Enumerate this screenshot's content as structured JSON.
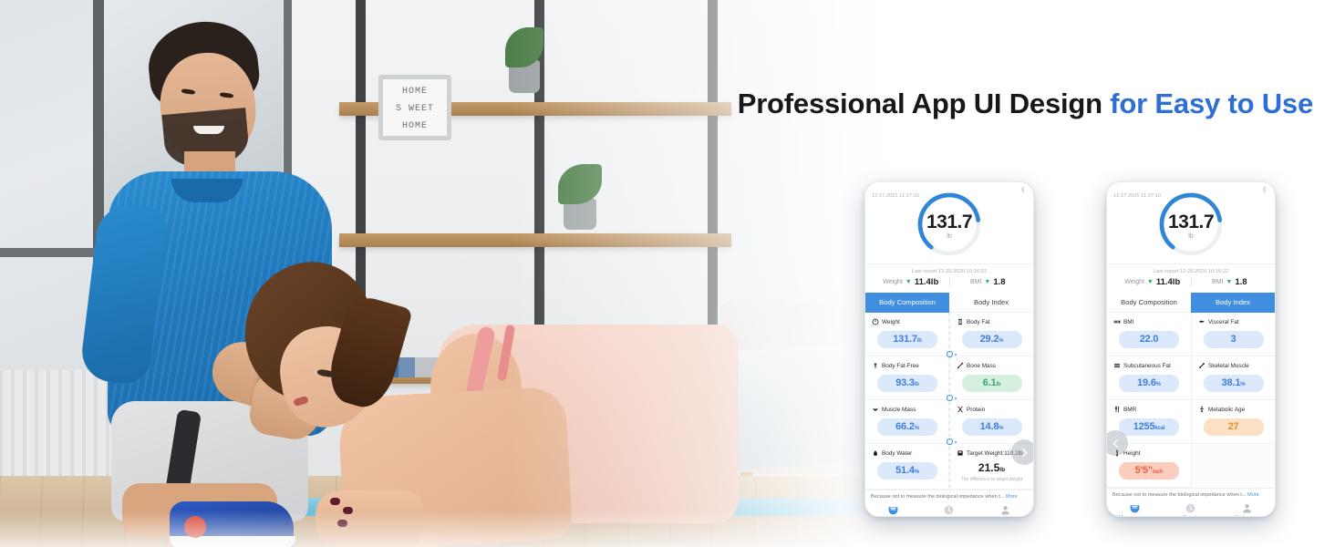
{
  "headline": {
    "text_main": "Professional App UI Design ",
    "text_accent": "for Easy to Use"
  },
  "phones": [
    {
      "id": "phone-1",
      "status": {
        "time": "12.17.2021 11:27:10",
        "bluetooth_icon": "bluetooth-icon"
      },
      "gauge": {
        "value": "131.7",
        "unit": "lb",
        "arc_color": "#2f86d8",
        "track_color": "#eceff1"
      },
      "last_report": "Last report 12.26.2020 10:16:22",
      "kpis": [
        {
          "label": "Weight",
          "arrow": "▼",
          "value": "11.4lb",
          "arrow_color": "#25b865"
        },
        {
          "label": "BMI",
          "arrow": "▼",
          "value": "1.8",
          "arrow_color": "#25b865"
        }
      ],
      "tabs": [
        {
          "label": "Body Composition",
          "active": true
        },
        {
          "label": "Body Index",
          "active": false
        }
      ],
      "cells": [
        {
          "icon": "body-weight-icon",
          "label": "Weight",
          "value": "131.7",
          "unit": "lb",
          "style": "pill-blue"
        },
        {
          "icon": "body-fat-icon",
          "label": "Body Fat",
          "value": "29.2",
          "unit": "%",
          "style": "pill-blue"
        },
        {
          "icon": "body-fat-free-icon",
          "label": "Body Fat-Free",
          "value": "93.3",
          "unit": "lb",
          "style": "pill-blue"
        },
        {
          "icon": "bone-mass-icon",
          "label": "Bone Mass",
          "value": "6.1",
          "unit": "lb",
          "style": "pill-green"
        },
        {
          "icon": "muscle-mass-icon",
          "label": "Muscle Mass",
          "value": "66.2",
          "unit": "%",
          "style": "pill-blue"
        },
        {
          "icon": "protein-icon",
          "label": "Protein",
          "value": "14.8",
          "unit": "%",
          "style": "pill-blue"
        },
        {
          "icon": "body-water-icon",
          "label": "Body Water",
          "value": "51.4",
          "unit": "%",
          "style": "pill-blue"
        },
        {
          "icon": "target-weight-icon",
          "label": "Target Weight:110.2lb",
          "value": "21.5",
          "unit": "lb",
          "style": "plain",
          "note": "The difference to target weight"
        }
      ],
      "arrow": {
        "name": "next-page-arrow",
        "glyph": "next"
      },
      "footnote": {
        "text": "Because not to measure the biological impedance when t...",
        "more": "More"
      },
      "bottom_nav": [
        {
          "icon": "measurements-icon",
          "label": "Measurements",
          "active": true
        },
        {
          "icon": "trends-icon",
          "label": "Trends",
          "active": false
        },
        {
          "icon": "account-icon",
          "label": "My Account",
          "active": false
        }
      ]
    },
    {
      "id": "phone-2",
      "status": {
        "time": "12.17.2021 11:27:10",
        "bluetooth_icon": "bluetooth-icon"
      },
      "gauge": {
        "value": "131.7",
        "unit": "lb",
        "arc_color": "#2f86d8",
        "track_color": "#eceff1"
      },
      "last_report": "Last report 12.26.2020 10:16:22",
      "kpis": [
        {
          "label": "Weight",
          "arrow": "▼",
          "value": "11.4lb",
          "arrow_color": "#25b865"
        },
        {
          "label": "BMI",
          "arrow": "▼",
          "value": "1.8",
          "arrow_color": "#25b865"
        }
      ],
      "tabs": [
        {
          "label": "Body Composition",
          "active": false
        },
        {
          "label": "Body Index",
          "active": true
        }
      ],
      "cells": [
        {
          "icon": "bmi-icon",
          "label": "BMI",
          "value": "22.0",
          "unit": "",
          "style": "pill-blue"
        },
        {
          "icon": "visceral-fat-icon",
          "label": "Visceral Fat",
          "value": "3",
          "unit": "",
          "style": "pill-blue"
        },
        {
          "icon": "subcutaneous-fat-icon",
          "label": "Subcutaneous Fat",
          "value": "19.6",
          "unit": "%",
          "style": "pill-blue"
        },
        {
          "icon": "skeletal-muscle-icon",
          "label": "Skeletal Muscle",
          "value": "38.1",
          "unit": "%",
          "style": "pill-blue"
        },
        {
          "icon": "bmr-icon",
          "label": "BMR",
          "value": "1255",
          "unit": "kcal",
          "style": "pill-blue"
        },
        {
          "icon": "metabolic-age-icon",
          "label": "Metabolic Age",
          "value": "27",
          "unit": "",
          "style": "pill-orange"
        },
        {
          "icon": "height-icon",
          "label": "Height",
          "value": "5'5\"",
          "unit": "inch",
          "style": "pill-salmon"
        },
        {
          "icon": "",
          "label": "",
          "value": "",
          "unit": "",
          "style": "empty"
        }
      ],
      "arrow": {
        "name": "prev-page-arrow",
        "glyph": "prev"
      },
      "footnote": {
        "text": "Because not to measure the biological impedance when t...",
        "more": "More"
      },
      "bottom_nav": [
        {
          "icon": "measurements-icon",
          "label": "Measurements",
          "active": true
        },
        {
          "icon": "trends-icon",
          "label": "Trends",
          "active": false
        },
        {
          "icon": "account-icon",
          "label": "My Account",
          "active": false
        }
      ]
    }
  ],
  "photo": {
    "wall_sign_line1": "HOME",
    "wall_sign_line2": "S WEET",
    "wall_sign_line3": "HOME"
  },
  "colors": {
    "accent_blue": "#3f8ee0",
    "headline_accent": "#2f6fd4",
    "pill_blue_bg": "#dce8fb",
    "pill_blue_text": "#3d7fe0",
    "pill_green_bg": "#d6f0df",
    "pill_green_text": "#35a96a",
    "pill_orange_bg": "#fbe0c4",
    "pill_orange_text": "#ef8a2a",
    "pill_salmon_bg": "#fbcdbf",
    "pill_salmon_text": "#f2603c"
  }
}
